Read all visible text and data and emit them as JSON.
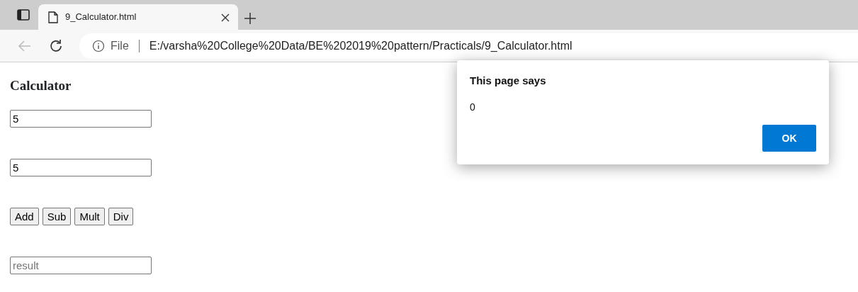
{
  "browser": {
    "tabs": [
      {
        "title": "9_Calculator.html",
        "selected": true
      }
    ],
    "address_bar": {
      "scheme_label": "File",
      "url": "E:/varsha%20College%20Data/BE%202019%20pattern/Practicals/9_Calculator.html"
    }
  },
  "page": {
    "heading": "Calculator",
    "inputs": [
      {
        "value": "5"
      },
      {
        "value": "5"
      }
    ],
    "buttons": [
      "Add",
      "Sub",
      "Mult",
      "Div"
    ],
    "result": {
      "placeholder": "result"
    }
  },
  "dialog": {
    "title": "This page says",
    "message": "0",
    "button": "OK"
  }
}
